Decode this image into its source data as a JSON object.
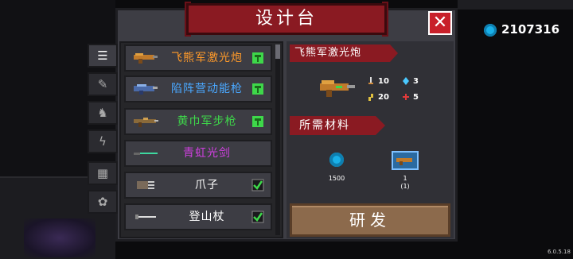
{
  "title": "设计台",
  "close_label": "✕",
  "currency": {
    "value": "2107316",
    "icon": "gem-coin-icon",
    "color": "#19b0e8"
  },
  "tabs": [
    {
      "icon": "list-icon",
      "glyph": "☰",
      "active": true
    },
    {
      "icon": "melee-weapon-icon",
      "glyph": "✎",
      "active": false
    },
    {
      "icon": "armor-icon",
      "glyph": "♞",
      "active": false
    },
    {
      "icon": "lightning-icon",
      "glyph": "ϟ",
      "active": false
    },
    {
      "icon": "furniture-icon",
      "glyph": "▦",
      "active": false
    },
    {
      "icon": "pet-icon",
      "glyph": "✿",
      "active": false
    }
  ],
  "weapon_list": [
    {
      "name": "飞熊军激光炮",
      "color": "#ff9a2a",
      "status": "hammer-icon"
    },
    {
      "name": "陷阵营动能枪",
      "color": "#4aa8ff",
      "status": "hammer-icon"
    },
    {
      "name": "黄巾军步枪",
      "color": "#3ed84a",
      "status": "hammer-icon"
    },
    {
      "name": "青虹光剑",
      "color": "#d040e0",
      "status": ""
    },
    {
      "name": "爪子",
      "color": "#ffffff",
      "status": "check-icon"
    },
    {
      "name": "登山杖",
      "color": "#ffffff",
      "status": "check-icon"
    }
  ],
  "detail": {
    "weapon_name": "飞熊军激光炮",
    "stats": {
      "damage": "10",
      "energy": "3",
      "crit": "20",
      "accuracy": "5"
    },
    "materials_label": "所需材料",
    "materials": [
      {
        "icon": "gem-coin-icon",
        "qty": "1500"
      },
      {
        "icon": "weapon-part-icon",
        "qty_top": "1",
        "qty_bottom": "(1)"
      }
    ],
    "research_label": "研发"
  },
  "version": "6.0.5.18"
}
